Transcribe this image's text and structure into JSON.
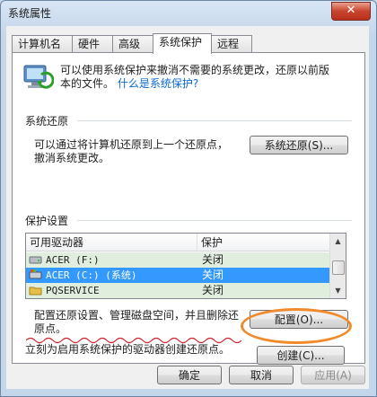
{
  "window": {
    "title": "系统属性",
    "close_label": "✕"
  },
  "tabs": [
    {
      "label": "计算机名"
    },
    {
      "label": "硬件"
    },
    {
      "label": "高级"
    },
    {
      "label": "系统保护",
      "active": true
    },
    {
      "label": "远程"
    }
  ],
  "intro": {
    "line1": "可以使用系统保护来撤消不需要的系统更改，还原以前版",
    "line2_prefix": "本的文件。",
    "link": "什么是系统保护?"
  },
  "restore_group": {
    "title": "系统还原",
    "desc_line1": "可以通过将计算机还原到上一个还原点，",
    "desc_line2": "撤消系统更改。",
    "button": "系统还原(S)..."
  },
  "protection_group": {
    "title": "保护设置",
    "columns": [
      "可用驱动器",
      "保护"
    ],
    "drives": [
      {
        "name": "ACER (F:)",
        "protection": "关闭",
        "selected": false
      },
      {
        "name": "ACER (C:) (系统)",
        "protection": "关闭",
        "selected": true
      },
      {
        "name": "PQSERVICE",
        "protection": "关闭",
        "selected": false
      }
    ],
    "config_line1": "配置还原设置、管理磁盘空间，并且删除还",
    "config_line2": "原点。",
    "config_button": "配置(O)...",
    "create_text": "立刻为启用系统保护的驱动器创建还原点。",
    "create_button": "创建(C)..."
  },
  "footer": {
    "ok": "确定",
    "cancel": "取消",
    "apply": "应用(A)"
  },
  "colors": {
    "annotation_oval": "#f08a2a",
    "annotation_underline": "#d0202a",
    "selection": "#3399ff"
  }
}
